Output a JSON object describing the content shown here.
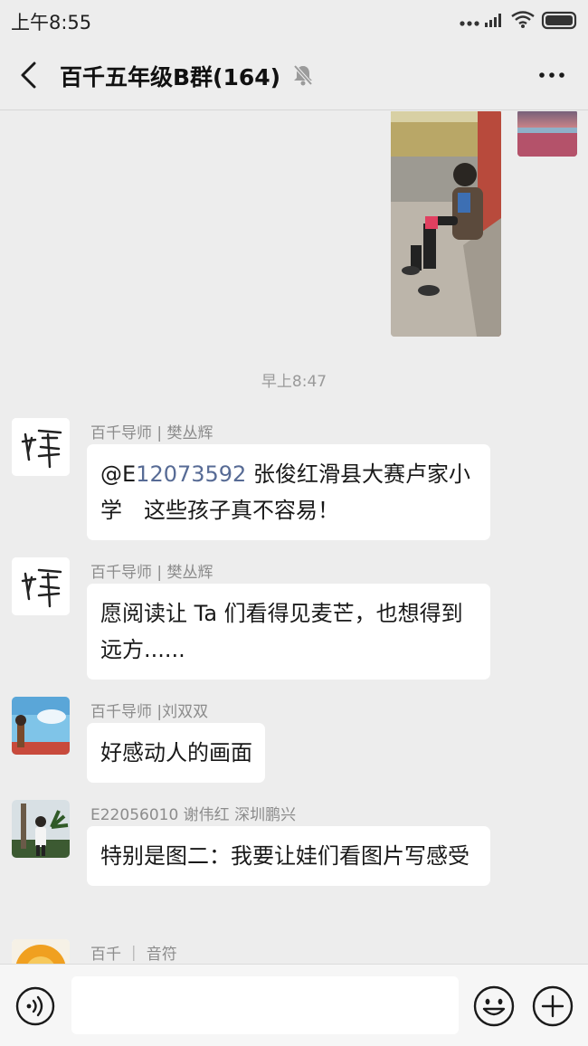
{
  "status_bar": {
    "time": "上午8:55"
  },
  "header": {
    "title": "百千五年级B群(164)"
  },
  "chat": {
    "timestamp": "早上8:47",
    "messages": [
      {
        "sender": "百千导师 | 樊丛辉",
        "text_prefix": "@E",
        "mention": "12073592",
        "text": " 张俊红滑县大赛卢家小学　这些孩子真不容易！"
      },
      {
        "sender": "百千导师 | 樊丛辉",
        "text": "愿阅读让 Ta 们看得见麦芒，也想得到远方......"
      },
      {
        "sender": "百千导师 |刘双双",
        "text": "好感动人的画面"
      },
      {
        "sender": "E22056010 谢伟红 深圳鹏兴",
        "text": "特别是图二：我要让娃们看图片写感受"
      },
      {
        "sender": "百千 ｜ 音符",
        "text": ""
      }
    ]
  },
  "input": {
    "value": "",
    "placeholder": ""
  },
  "icons": {
    "back": "back-arrow-icon",
    "mute": "mute-bell-icon",
    "more": "more-dots-icon",
    "voice": "voice-icon",
    "emoji": "emoji-icon",
    "plus": "plus-icon"
  },
  "colors": {
    "background": "#ededed",
    "bubble": "#ffffff",
    "mention": "#576b95",
    "meta_text": "#8c8c8c"
  }
}
